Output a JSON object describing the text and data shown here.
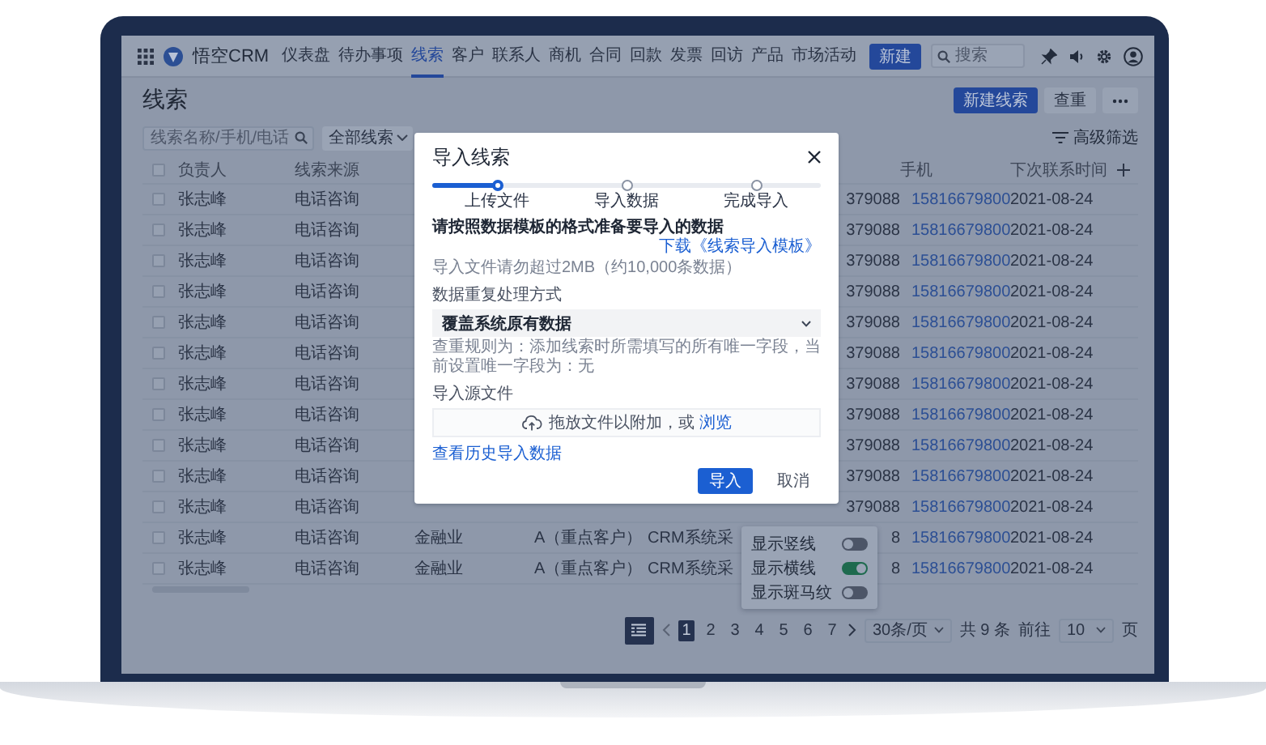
{
  "nav": {
    "brand": "悟空CRM",
    "items": [
      {
        "label": "仪表盘",
        "selected": false
      },
      {
        "label": "待办事项",
        "selected": false
      },
      {
        "label": "线索",
        "selected": true
      },
      {
        "label": "客户",
        "selected": false
      },
      {
        "label": "联系人",
        "selected": false
      },
      {
        "label": "商机",
        "selected": false
      },
      {
        "label": "合同",
        "selected": false
      },
      {
        "label": "回款",
        "selected": false
      },
      {
        "label": "发票",
        "selected": false
      },
      {
        "label": "回访",
        "selected": false
      },
      {
        "label": "产品",
        "selected": false
      },
      {
        "label": "市场活动",
        "selected": false
      }
    ],
    "new_button": "新建",
    "search": {
      "placeholder": "搜索"
    }
  },
  "page": {
    "title": "线索",
    "buttons": [
      {
        "label": "新建线索",
        "kind": "primary"
      },
      {
        "label": "查重",
        "kind": "plain"
      }
    ]
  },
  "filters": {
    "search": {
      "placeholder": "线索名称/手机/电话"
    },
    "scope": "全部线索",
    "advanced": "高级筛选"
  },
  "table": {
    "columns": [
      "负责人",
      "线索来源",
      "手机",
      "下次联系时间"
    ],
    "header_checked": false,
    "rows": [
      {
        "checked": false,
        "owner": "张志峰",
        "source": "电话咨询",
        "column_6": "379088",
        "phone": "15816679800",
        "next_contact": "2021-08-24"
      },
      {
        "checked": false,
        "owner": "张志峰",
        "source": "电话咨询",
        "column_6": "379088",
        "phone": "15816679800",
        "next_contact": "2021-08-24"
      },
      {
        "checked": false,
        "owner": "张志峰",
        "source": "电话咨询",
        "column_6": "379088",
        "phone": "15816679800",
        "next_contact": "2021-08-24"
      },
      {
        "checked": false,
        "owner": "张志峰",
        "source": "电话咨询",
        "column_6": "379088",
        "phone": "15816679800",
        "next_contact": "2021-08-24"
      },
      {
        "checked": false,
        "owner": "张志峰",
        "source": "电话咨询",
        "column_6": "379088",
        "phone": "15816679800",
        "next_contact": "2021-08-24"
      },
      {
        "checked": false,
        "owner": "张志峰",
        "source": "电话咨询",
        "column_6": "379088",
        "phone": "15816679800",
        "next_contact": "2021-08-24"
      },
      {
        "checked": false,
        "owner": "张志峰",
        "source": "电话咨询",
        "column_6": "379088",
        "phone": "15816679800",
        "next_contact": "2021-08-24"
      },
      {
        "checked": false,
        "owner": "张志峰",
        "source": "电话咨询",
        "column_6": "379088",
        "phone": "15816679800",
        "next_contact": "2021-08-24"
      },
      {
        "checked": false,
        "owner": "张志峰",
        "source": "电话咨询",
        "column_6": "379088",
        "phone": "15816679800",
        "next_contact": "2021-08-24"
      },
      {
        "checked": false,
        "owner": "张志峰",
        "source": "电话咨询",
        "column_6": "379088",
        "phone": "15816679800",
        "next_contact": "2021-08-24"
      },
      {
        "checked": false,
        "owner": "张志峰",
        "source": "电话咨询",
        "column_6": "379088",
        "phone": "15816679800",
        "next_contact": "2021-08-24"
      },
      {
        "checked": false,
        "owner": "张志峰",
        "source": "电话咨询",
        "column_3": "金融业",
        "column_4": "A（重点客户）",
        "column_5": "CRM系统采",
        "column_6": "8",
        "phone": "15816679800",
        "next_contact": "2021-08-24"
      },
      {
        "checked": false,
        "owner": "张志峰",
        "source": "电话咨询",
        "column_3": "金融业",
        "column_4": "A（重点客户）",
        "column_5": "CRM系统采",
        "column_6": "8",
        "phone": "15816679800",
        "next_contact": "2021-08-24"
      }
    ]
  },
  "popover": {
    "toggles": [
      {
        "label": "显示竖线",
        "on": false
      },
      {
        "label": "显示横线",
        "on": true
      },
      {
        "label": "显示斑马纹",
        "on": false
      }
    ]
  },
  "pagination": {
    "pages": [
      {
        "label": "1",
        "selected": true
      },
      {
        "label": "2",
        "selected": false
      },
      {
        "label": "3",
        "selected": false
      },
      {
        "label": "4",
        "selected": false
      },
      {
        "label": "5",
        "selected": false
      },
      {
        "label": "6",
        "selected": false
      },
      {
        "label": "7",
        "selected": false
      }
    ],
    "page_size": "30条/页",
    "total": "共 9 条",
    "goto_label": "前往",
    "goto_value": "10",
    "goto_unit": "页"
  },
  "dialog": {
    "title": "导入线索",
    "progress": {
      "level": 0.167
    },
    "steps": [
      {
        "label": "上传文件",
        "selected": true
      },
      {
        "label": "导入数据",
        "selected": false
      },
      {
        "label": "完成导入",
        "selected": false
      }
    ],
    "heading": "请按照数据模板的格式准备要导入的数据",
    "template_link": "下载《线索导入模板》",
    "note": "导入文件请勿超过2MB（约10,000条数据）",
    "duplicate_label": "数据重复处理方式",
    "duplicate_value": "覆盖系统原有数据",
    "duplicate_hint": "查重规则为：添加线索时所需填写的所有唯一字段，当前设置唯一字段为：无",
    "source_label": "导入源文件",
    "upload_text": "拖放文件以附加，或",
    "browse_link": "浏览",
    "history_link": "查看历史导入数据",
    "buttons": [
      {
        "label": "导入",
        "kind": "primary"
      },
      {
        "label": "取消",
        "kind": "plain"
      }
    ]
  }
}
